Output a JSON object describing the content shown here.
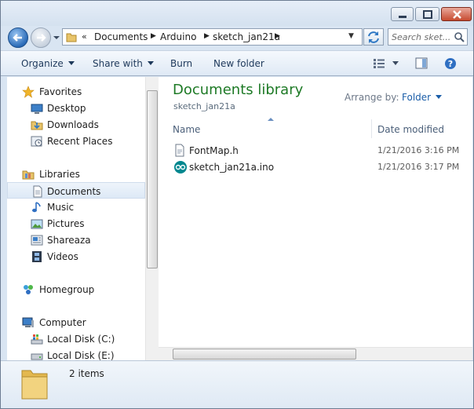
{
  "window": {
    "controls": {
      "minimize_icon": "minimize-icon",
      "maximize_icon": "maximize-icon",
      "close_icon": "close-icon"
    }
  },
  "address": {
    "overflow_chevron": "«",
    "breadcrumbs": [
      "Documents",
      "Arduino",
      "sketch_jan21a"
    ]
  },
  "search": {
    "placeholder": "Search sket..."
  },
  "toolbar": {
    "organize_label": "Organize",
    "share_label": "Share with",
    "burn_label": "Burn",
    "new_folder_label": "New folder"
  },
  "sidebar": {
    "favorites": {
      "label": "Favorites",
      "items": [
        "Desktop",
        "Downloads",
        "Recent Places"
      ]
    },
    "libraries": {
      "label": "Libraries",
      "items": [
        "Documents",
        "Music",
        "Pictures",
        "Shareaza",
        "Videos"
      ],
      "selected": "Documents"
    },
    "homegroup": {
      "label": "Homegroup"
    },
    "computer": {
      "label": "Computer",
      "items": [
        "Local Disk (C:)",
        "Local Disk (E:)"
      ]
    }
  },
  "library": {
    "title": "Documents library",
    "subtitle": "sketch_jan21a",
    "arrange_label": "Arrange by:",
    "arrange_value": "Folder"
  },
  "columns": {
    "name": "Name",
    "date": "Date modified"
  },
  "files": [
    {
      "name": "FontMap.h",
      "date": "1/21/2016 3:16 PM",
      "icon": "header-file-icon"
    },
    {
      "name": "sketch_jan21a.ino",
      "date": "1/21/2016 3:17 PM",
      "icon": "arduino-file-icon"
    }
  ],
  "details": {
    "count": "2 items"
  },
  "colors": {
    "title_green": "#1e7a26",
    "link_blue": "#1a5da8",
    "selection": "#dde9f6"
  }
}
